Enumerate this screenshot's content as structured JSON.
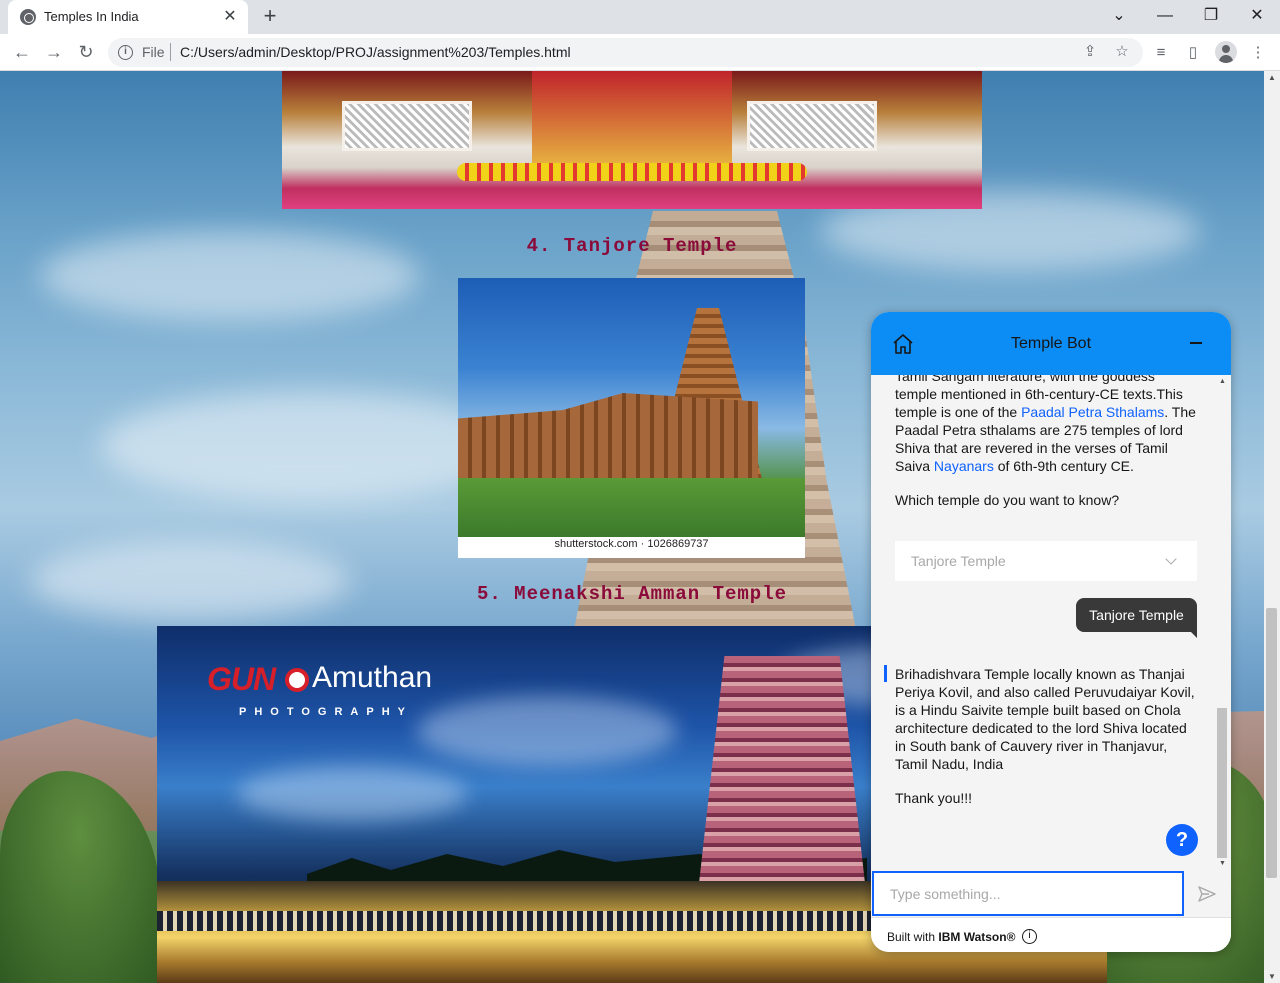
{
  "browser": {
    "tab_title": "Temples In India",
    "url_scheme": "File",
    "url": "C:/Users/admin/Desktop/PROJ/assignment%203/Temples.html"
  },
  "page": {
    "heading_4": "4. Tanjore Temple",
    "heading_5": "5. Meenakshi Amman Temple",
    "tanjore_photo_credit": "shutterstock.com · 1026869737",
    "logo_guna": "GUN",
    "logo_amuthan": "Amuthan",
    "logo_photography": "PHOTOGRAPHY"
  },
  "chat": {
    "title": "Temple Bot",
    "prev_fragment": "Tamil Sangam literature, with the goddess",
    "prev_line1": "temple mentioned in 6th-century-CE texts.This temple is one of the ",
    "prev_link1": "Paadal Petra Sthalams",
    "prev_line2": ". The Paadal Petra sthalams are 275 temples of lord Shiva that are revered in the verses of Tamil Saiva ",
    "prev_link2": "Nayanars",
    "prev_line3": " of 6th-9th century CE.",
    "question": "Which temple do you want to know?",
    "dropdown_value": "Tanjore Temple",
    "user_message": "Tanjore Temple",
    "bot_answer": "Brihadishvara Temple locally known as Thanjai Periya Kovil, and also called Peruvudaiyar Kovil, is a Hindu Saivite temple built based on Chola architecture dedicated to the lord Shiva located in South bank of Cauvery river in Thanjavur, Tamil Nadu, India",
    "thanks": "Thank you!!!",
    "input_placeholder": "Type something...",
    "footer_prefix": "Built with ",
    "footer_brand": "IBM Watson®",
    "accent_color": "#0f62fe",
    "header_color": "#0c8cf5"
  },
  "icons": [
    "favicon-icon",
    "close-icon",
    "plus-icon",
    "back-icon",
    "forward-icon",
    "reload-icon",
    "info-icon",
    "share-icon",
    "star-icon",
    "media-icon",
    "sidepanel-icon",
    "profile-icon",
    "menu-icon",
    "home-icon",
    "minimize-icon",
    "chevron-down-icon",
    "help-icon",
    "send-icon"
  ]
}
